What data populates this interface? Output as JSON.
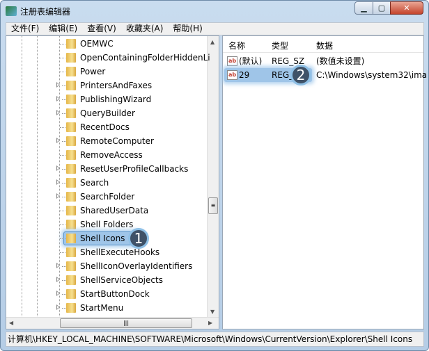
{
  "window": {
    "title": "注册表编辑器",
    "controls": [
      "minimize",
      "maximize",
      "close"
    ]
  },
  "menu": [
    "文件(F)",
    "编辑(E)",
    "查看(V)",
    "收藏夹(A)",
    "帮助(H)"
  ],
  "tree": {
    "items": [
      {
        "label": "OEMWC",
        "expandable": false
      },
      {
        "label": "OpenContainingFolderHiddenLi",
        "expandable": false
      },
      {
        "label": "Power",
        "expandable": false
      },
      {
        "label": "PrintersAndFaxes",
        "expandable": true
      },
      {
        "label": "PublishingWizard",
        "expandable": true
      },
      {
        "label": "QueryBuilder",
        "expandable": true
      },
      {
        "label": "RecentDocs",
        "expandable": false
      },
      {
        "label": "RemoteComputer",
        "expandable": true
      },
      {
        "label": "RemoveAccess",
        "expandable": false
      },
      {
        "label": "ResetUserProfileCallbacks",
        "expandable": true
      },
      {
        "label": "Search",
        "expandable": true
      },
      {
        "label": "SearchFolder",
        "expandable": true
      },
      {
        "label": "SharedUserData",
        "expandable": false
      },
      {
        "label": "Shell Folders",
        "expandable": false
      },
      {
        "label": "Shell Icons",
        "expandable": false,
        "selected": true
      },
      {
        "label": "ShellExecuteHooks",
        "expandable": false
      },
      {
        "label": "ShellIconOverlayIdentifiers",
        "expandable": true
      },
      {
        "label": "ShellServiceObjects",
        "expandable": true
      },
      {
        "label": "StartButtonDock",
        "expandable": true
      },
      {
        "label": "StartMenu",
        "expandable": true
      }
    ],
    "callout": "1"
  },
  "list": {
    "headers": [
      "名称",
      "类型",
      "数据"
    ],
    "rows": [
      {
        "name": "(默认)",
        "type": "REG_SZ",
        "data": "(数值未设置)"
      },
      {
        "name": "29",
        "type": "REG_SZ",
        "data": "C:\\Windows\\system32\\ima",
        "selected": true
      }
    ],
    "callout": "2"
  },
  "status": "计算机\\HKEY_LOCAL_MACHINE\\SOFTWARE\\Microsoft\\Windows\\CurrentVersion\\Explorer\\Shell Icons"
}
